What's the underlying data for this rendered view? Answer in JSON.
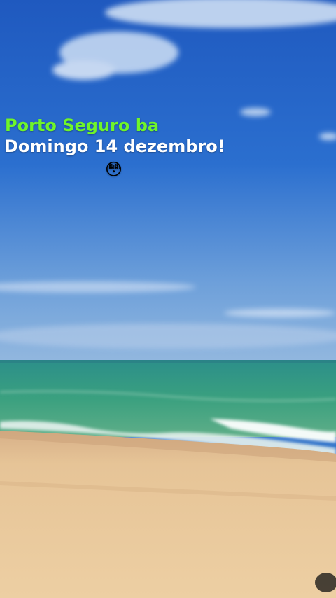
{
  "overlay": {
    "line1": "Porto Seguro ba",
    "line2": "Domingo 14 dezembro!",
    "emoji": "😳"
  },
  "colors": {
    "line1": "#6ff52a",
    "line2": "#ffffff",
    "sky_top": "#1d5fc4",
    "sea": "#2f9a82",
    "sand": "#e6c293"
  }
}
